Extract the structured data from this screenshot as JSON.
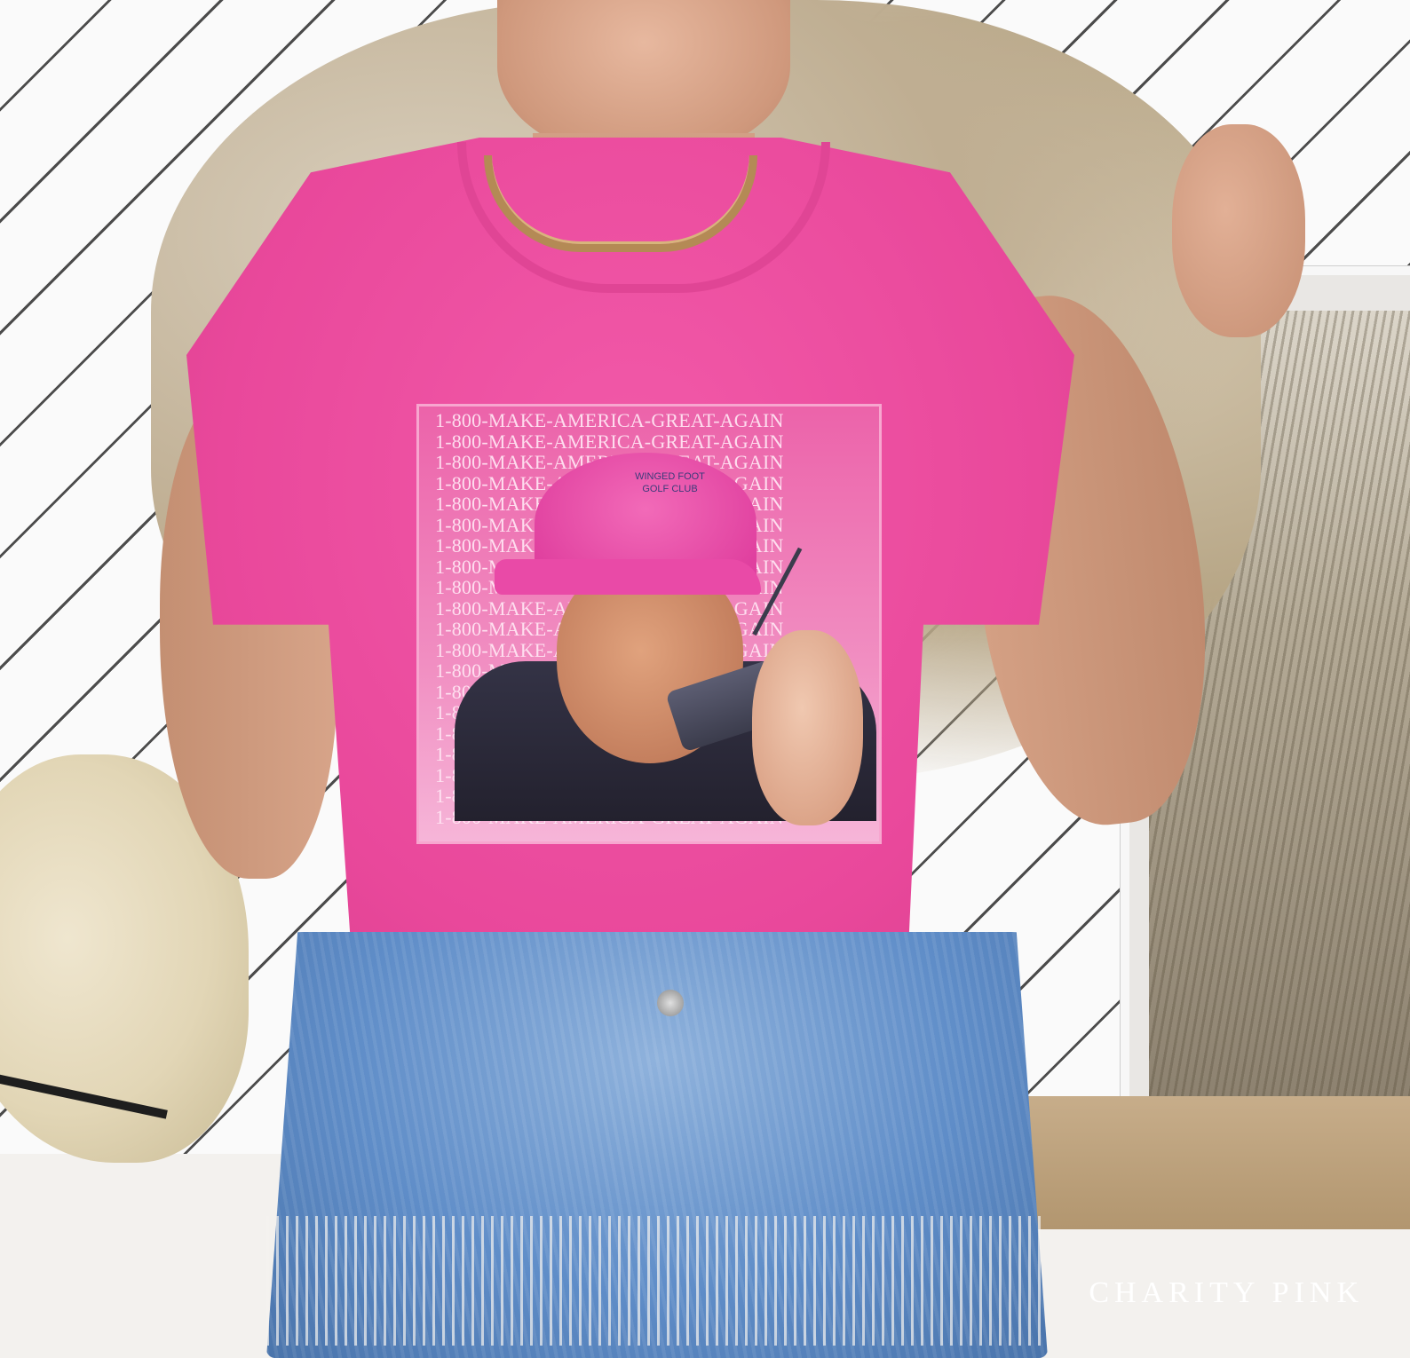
{
  "color_name": "CHARITY PINK",
  "print": {
    "repeated_text": "1-800-MAKE-AMERICA-GREAT-AGAIN",
    "line_count": 20,
    "cap_logo_text": "WINGED FOOT GOLF CLUB"
  },
  "colors": {
    "shirt": "#e9489b",
    "denim": "#5f8dc8",
    "caption_text": "#ffffff"
  }
}
